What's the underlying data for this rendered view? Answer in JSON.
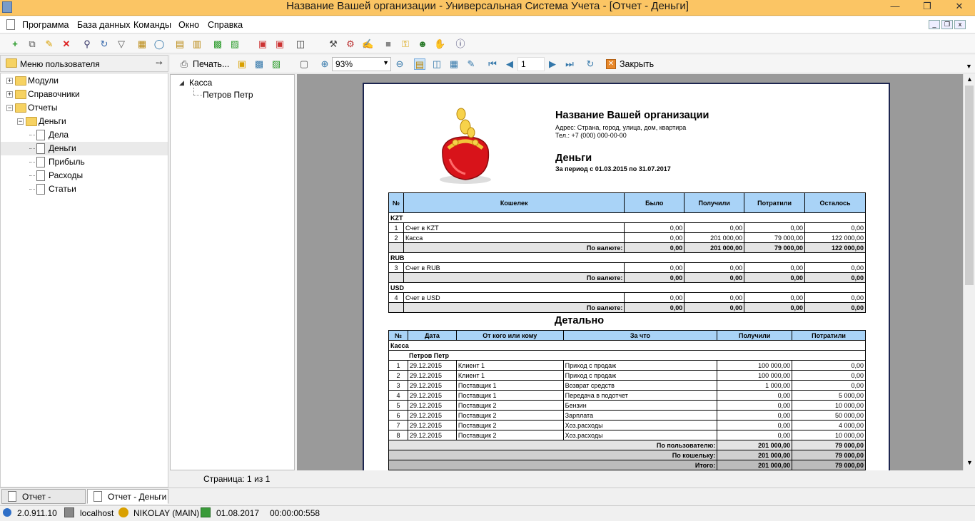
{
  "window": {
    "title": "Название Вашей организации - Универсальная Система Учета - [Отчет - Деньги]"
  },
  "menu": [
    "Программа",
    "База данных",
    "Команды",
    "Окно",
    "Справка"
  ],
  "left_panel": {
    "header": "Меню пользователя",
    "tree": [
      {
        "label": "Модули",
        "level": 0,
        "kind": "folder",
        "expander": "+"
      },
      {
        "label": "Справочники",
        "level": 0,
        "kind": "folder",
        "expander": "+"
      },
      {
        "label": "Отчеты",
        "level": 0,
        "kind": "folder",
        "expander": "-"
      },
      {
        "label": "Деньги",
        "level": 1,
        "kind": "folder",
        "expander": "-"
      },
      {
        "label": "Дела",
        "level": 2,
        "kind": "doc"
      },
      {
        "label": "Деньги",
        "level": 2,
        "kind": "doc",
        "selected": true
      },
      {
        "label": "Прибыль",
        "level": 2,
        "kind": "doc"
      },
      {
        "label": "Расходы",
        "level": 2,
        "kind": "doc"
      },
      {
        "label": "Статьи",
        "level": 2,
        "kind": "doc"
      }
    ]
  },
  "report_toolbar": {
    "print_label": "Печать...",
    "zoom": "93%",
    "page_input": "1",
    "close_label": "Закрыть"
  },
  "mid_tree": {
    "root": "Касса",
    "child": "Петров Петр"
  },
  "status_page": "Страница: 1 из 1",
  "tabs": [
    "Отчет - Расходы",
    "Отчет - Деньги"
  ],
  "statusbar": {
    "version": "2.0.911.10",
    "server": "localhost",
    "user": "NIKOLAY (MAIN)",
    "date": "01.08.2017",
    "time": "00:00:00:558"
  },
  "report": {
    "org_name": "Название Вашей организации",
    "address": "Адрес: Страна, город, улица, дом, квартира",
    "phone": "Тел.: +7 (000) 000-00-00",
    "title": "Деньги",
    "period": "За период с 01.03.2015 по 31.07.2017",
    "summary_headers": [
      "№",
      "Кошелек",
      "Было",
      "Получили",
      "Потратили",
      "Осталось"
    ],
    "currencies": [
      {
        "code": "KZT",
        "rows": [
          [
            "1",
            "Счет в KZT",
            "0,00",
            "0,00",
            "0,00",
            "0,00"
          ],
          [
            "2",
            "Касса",
            "0,00",
            "201 000,00",
            "79 000,00",
            "122 000,00"
          ]
        ],
        "total": [
          "0,00",
          "201 000,00",
          "79 000,00",
          "122 000,00"
        ]
      },
      {
        "code": "RUB",
        "rows": [
          [
            "3",
            "Счет в RUB",
            "0,00",
            "0,00",
            "0,00",
            "0,00"
          ]
        ],
        "total": [
          "0,00",
          "0,00",
          "0,00",
          "0,00"
        ]
      },
      {
        "code": "USD",
        "rows": [
          [
            "4",
            "Счет в USD",
            "0,00",
            "0,00",
            "0,00",
            "0,00"
          ]
        ],
        "total": [
          "0,00",
          "0,00",
          "0,00",
          "0,00"
        ]
      }
    ],
    "by_currency_label": "По валюте:",
    "detail_title": "Детально",
    "detail_headers": [
      "№",
      "Дата",
      "От кого или кому",
      "За что",
      "Получили",
      "Потратили"
    ],
    "detail_group": "Касса",
    "detail_subgroup": "Петров Петр",
    "detail_rows": [
      [
        "1",
        "29.12.2015",
        "Клиент 1",
        "Приход с продаж",
        "100 000,00",
        "0,00"
      ],
      [
        "2",
        "29.12.2015",
        "Клиент 1",
        "Приход с продаж",
        "100 000,00",
        "0,00"
      ],
      [
        "3",
        "29.12.2015",
        "Поставщик 1",
        "Возврат средств",
        "1 000,00",
        "0,00"
      ],
      [
        "4",
        "29.12.2015",
        "Поставщик 1",
        "Передача в подотчет",
        "0,00",
        "5 000,00"
      ],
      [
        "5",
        "29.12.2015",
        "Поставщик 2",
        "Бензин",
        "0,00",
        "10 000,00"
      ],
      [
        "6",
        "29.12.2015",
        "Поставщик 2",
        "Зарплата",
        "0,00",
        "50 000,00"
      ],
      [
        "7",
        "29.12.2015",
        "Поставщик 2",
        "Хоз.расходы",
        "0,00",
        "4 000,00"
      ],
      [
        "8",
        "29.12.2015",
        "Поставщик 2",
        "Хоз.расходы",
        "0,00",
        "10 000,00"
      ]
    ],
    "totals": [
      {
        "label": "По пользователю:",
        "in": "201 000,00",
        "out": "79 000,00"
      },
      {
        "label": "По кошельку:",
        "in": "201 000,00",
        "out": "79 000,00"
      },
      {
        "label": "Итого:",
        "in": "201 000,00",
        "out": "79 000,00"
      }
    ]
  },
  "colors": {
    "titlebar": "#fbc564",
    "table_header": "#a9d3f7",
    "page_border": "#1d2650"
  }
}
